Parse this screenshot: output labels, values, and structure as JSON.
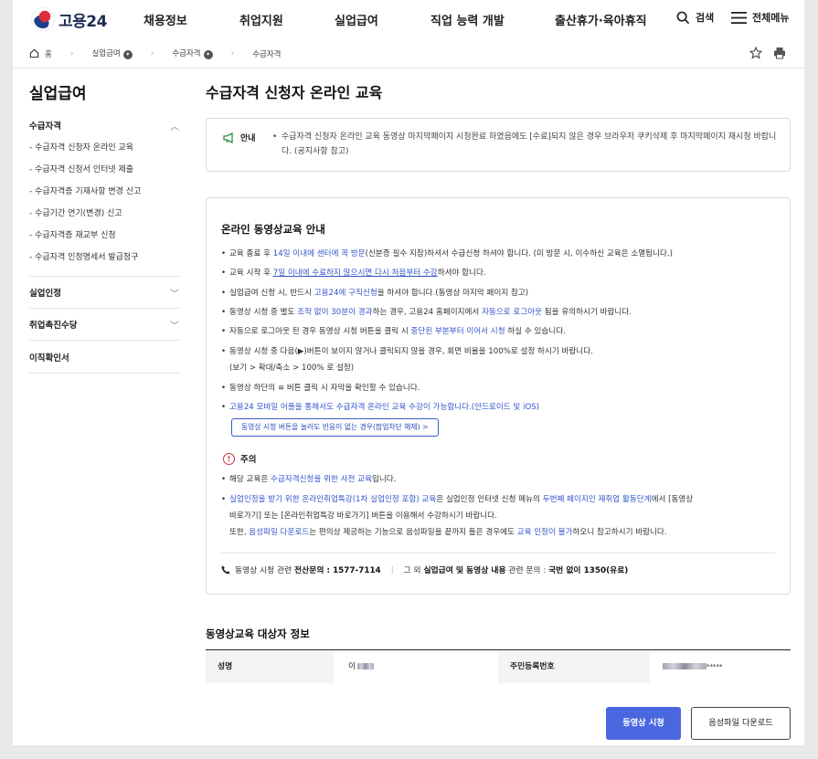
{
  "header": {
    "logo_text": "고용24",
    "menu": [
      "채용정보",
      "취업지원",
      "실업급여",
      "직업 능력 개발",
      "출산휴가·육아휴직"
    ],
    "search_label": "검색",
    "all_menu_label": "전체메뉴"
  },
  "breadcrumb": [
    "홈",
    "실업급여",
    "수급자격",
    "수급자격"
  ],
  "sidebar": {
    "title": "실업급여",
    "sections": [
      {
        "label": "수급자격",
        "expanded": true,
        "items": [
          "- 수급자격 신청자 온라인 교육",
          "- 수급자격 신청서 인터넷 제출",
          "- 수급자격증 기재사항 변경 신고",
          "- 수급기간 연기(변경) 신고",
          "- 수급자격증 재교부 신청",
          "- 수급자격 인정명세서 발급청구"
        ]
      },
      {
        "label": "실업인정",
        "expanded": false,
        "items": []
      },
      {
        "label": "취업촉진수당",
        "expanded": false,
        "items": []
      },
      {
        "label": "이직확인서",
        "expanded": false,
        "items": []
      }
    ]
  },
  "main": {
    "title": "수급자격 신청자 온라인 교육",
    "notice": {
      "label": "안내",
      "text": "수급자격 신청자 온라인 교육 동영상 마지막페이지 시청완료 하였음에도 [수료]되지 않은 경우 브라우저 쿠키삭제 후 마지막페이지 재시청 바랍니다. (공지사항 참고)"
    },
    "card": {
      "heading": "온라인 동영상교육 안내",
      "bullets": {
        "b1": {
          "p1": "교육 종료 후 ",
          "h1": "14일 이내에 센터에 꼭 방문",
          "p2": "(신분증 필수 지참)하셔서 수급신청 하셔야 합니다. (미 방문 시, 이수하신 교육은 소멸됩니다.)"
        },
        "b2": {
          "p1": "교육 시작 후 ",
          "h1": "7일 이내에 수료하지 않으시면 다시 처음부터 수강",
          "p2": "하셔야 합니다."
        },
        "b3": {
          "p1": "실업급여 신청 시, 반드시 ",
          "h1": "고용24에 구직신청",
          "p2": "을 하셔야 합니다.(동영상 마지막 페이지 참고)"
        },
        "b4": {
          "p1": "동영상 시청 중 별도 ",
          "h1": "조작 없이 30분이 경과",
          "p2": "하는 경우, 고용24 홈페이지에서 ",
          "h2": "자동으로 로그아웃",
          "p3": " 됨을 유의하시기 바랍니다."
        },
        "b5": {
          "p1": "자동으로 로그아웃 된 경우 동영상 시청 버튼을 클릭 시 ",
          "h1": "중단된 부분부터 이어서 시청",
          "p2": " 하실 수 있습니다."
        },
        "b6": {
          "p1": "동영상 시청 중 다음(▶)버튼이 보이지 않거나 클릭되지 않을 경우, 회면 비율을 100%로 설정 하시기 바랍니다.",
          "p2": "(보기 > 확대/축소 > 100% 로 설정)"
        },
        "b7": {
          "p1": "동영상 하단의 ≡ 버튼 클릭 시 자막을 확인할 수 있습니다."
        },
        "b8": {
          "h1": "고용24 모바일 어플을 통해서도 수급자격 온라인 교육 수강이 가능합니다.",
          "p1": "(안드로이드 및 iOS)"
        }
      },
      "popup_button": "동영상 시청 버튼을 눌러도 반응이 없는 경우(팝업차단 해제) >",
      "caution_label": "주의",
      "caution": {
        "c1": {
          "p1": "해당 교육은 ",
          "h1": "수급자격신청을 위한 사전 교육",
          "p2": "입니다."
        },
        "c2": {
          "h1": "실업인정을 받기 위한 온라인취업특강(1차 실업인정 포함) 교육",
          "p1": "은 실업인정 인터넷 신청 메뉴의 ",
          "h2": "두번째 페이지인 재취업 활동단계",
          "p2": "에서 [동영상",
          "p3": "바로가기] 또는 [온라인취업특강 바로가기] 버튼을 이용해서 수강하시기 바랍니다.",
          "p4": "또한, ",
          "h3": "음성파일 다운로드",
          "p5": "는 편의상 제공하는 기능으로 음성파일을 끝까지 들은 경우에도 ",
          "h4": "교육 인정이 불가",
          "p6": "하오니 참고하시기 바랍니다."
        }
      },
      "contact": {
        "p1": "동영상 시청 관련 ",
        "k1": "전산문의 : 1577-7114",
        "p2": "그 외 ",
        "k2": "실업급여 및 동영상 내용",
        "p3": " 관련 문의 : ",
        "k3": "국번 없이 1350(유료)"
      }
    },
    "info": {
      "heading": "동영상교육 대상자 정보",
      "name_label": "성명",
      "name_value_prefix": "이",
      "id_label": "주민등록번호",
      "id_value_suffix": "*****"
    },
    "buttons": {
      "watch": "동영상 시청",
      "download": "음성파일 다운로드"
    }
  }
}
